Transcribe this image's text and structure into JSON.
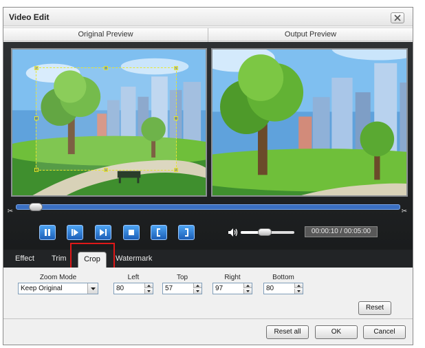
{
  "window": {
    "title": "Video Edit"
  },
  "preview": {
    "original_label": "Original Preview",
    "output_label": "Output Preview"
  },
  "playback": {
    "time": "00:00:10 / 00:05:00",
    "seek_fraction": 0.033,
    "volume_fraction": 0.45
  },
  "tabs": [
    {
      "label": "Effect"
    },
    {
      "label": "Trim"
    },
    {
      "label": "Crop",
      "selected": true
    },
    {
      "label": "Watermark"
    }
  ],
  "crop": {
    "zoom_mode": {
      "label": "Zoom Mode",
      "value": "Keep Original"
    },
    "left": {
      "label": "Left",
      "value": "80"
    },
    "top": {
      "label": "Top",
      "value": "57"
    },
    "right": {
      "label": "Right",
      "value": "97"
    },
    "bottom": {
      "label": "Bottom",
      "value": "80"
    },
    "reset_label": "Reset"
  },
  "footer": {
    "reset_all_label": "Reset all",
    "ok_label": "OK",
    "cancel_label": "Cancel"
  },
  "colors": {
    "highlight": "#e01818",
    "crop_box": "#e8e62c",
    "control_blue": "#2f7fe0"
  },
  "icons": [
    "close-icon",
    "pause-icon",
    "play-icon",
    "next-frame-icon",
    "stop-icon",
    "mark-in-icon",
    "mark-out-icon",
    "volume-icon",
    "scissor-icon"
  ]
}
